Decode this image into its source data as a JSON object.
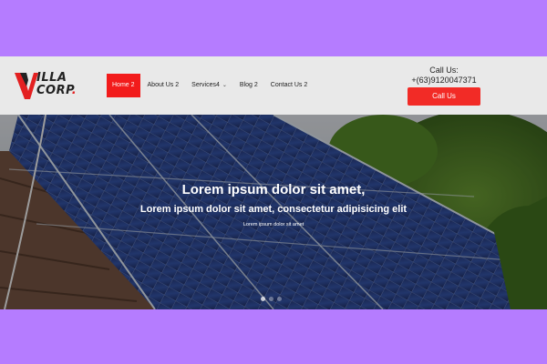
{
  "logo": {
    "line1": "ILLA",
    "line2": "CORP",
    "dot": "."
  },
  "nav": {
    "items": [
      {
        "label": "Home 2",
        "active": true
      },
      {
        "label": "About Us 2"
      },
      {
        "label": "Services4",
        "dropdown": true
      },
      {
        "label": "Blog 2"
      },
      {
        "label": "Contact Us 2"
      }
    ]
  },
  "contact": {
    "label": "Call Us:",
    "phone": "+(63)9120047371",
    "button": "Call Us"
  },
  "hero": {
    "title": "Lorem ipsum dolor sit amet,",
    "subtitle": "Lorem ipsum dolor sit amet, consectetur adipisicing elit",
    "small": "Lorem ipsum dolor sit amet",
    "slides": 3,
    "active_slide": 1
  },
  "colors": {
    "accent": "#f21b1b",
    "page_bg": "#b57cff",
    "header_bg": "#e9e9e9"
  }
}
